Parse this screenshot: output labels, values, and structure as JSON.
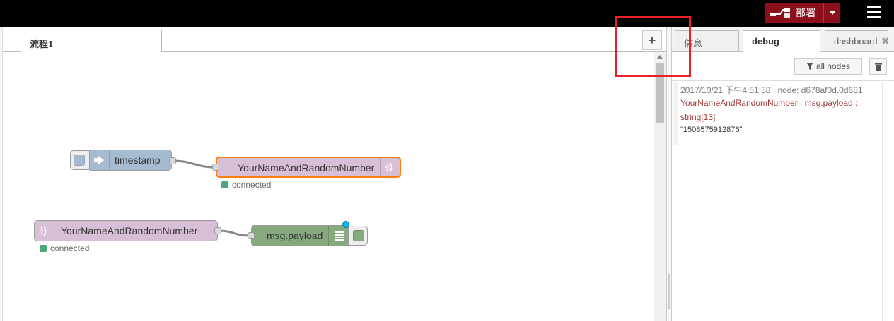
{
  "header": {
    "deploy_label": "部署"
  },
  "workspace": {
    "tabs": [
      {
        "label": "流程1"
      }
    ],
    "add_tab_label": "+",
    "nodes": [
      {
        "label": "timestamp"
      },
      {
        "label": "YourNameAndRandomNumber",
        "status": "connected"
      },
      {
        "label": "YourNameAndRandomNumber",
        "status": "connected"
      },
      {
        "label": "msg.payload"
      }
    ]
  },
  "sidebar": {
    "tabs": [
      {
        "label": "信息"
      },
      {
        "label": "debug"
      },
      {
        "label": "dashboard"
      }
    ],
    "filter_label": "all nodes",
    "messages": [
      {
        "timestamp": "2017/10/21 下午4:51:58",
        "node": "node: d678af0d.0d681",
        "topic": "YourNameAndRandomNumber : msg.payload : string[13]",
        "value": "\"1508575912876\""
      }
    ]
  },
  "colors": {
    "deploy": "#8c101c",
    "inject": "#a6bbcf",
    "websocket": "#d7bfd7",
    "debug": "#87a980",
    "selected_border": "#ff7f0e",
    "status_connected": "#4ba77a",
    "highlight_box": "#e8212b"
  }
}
